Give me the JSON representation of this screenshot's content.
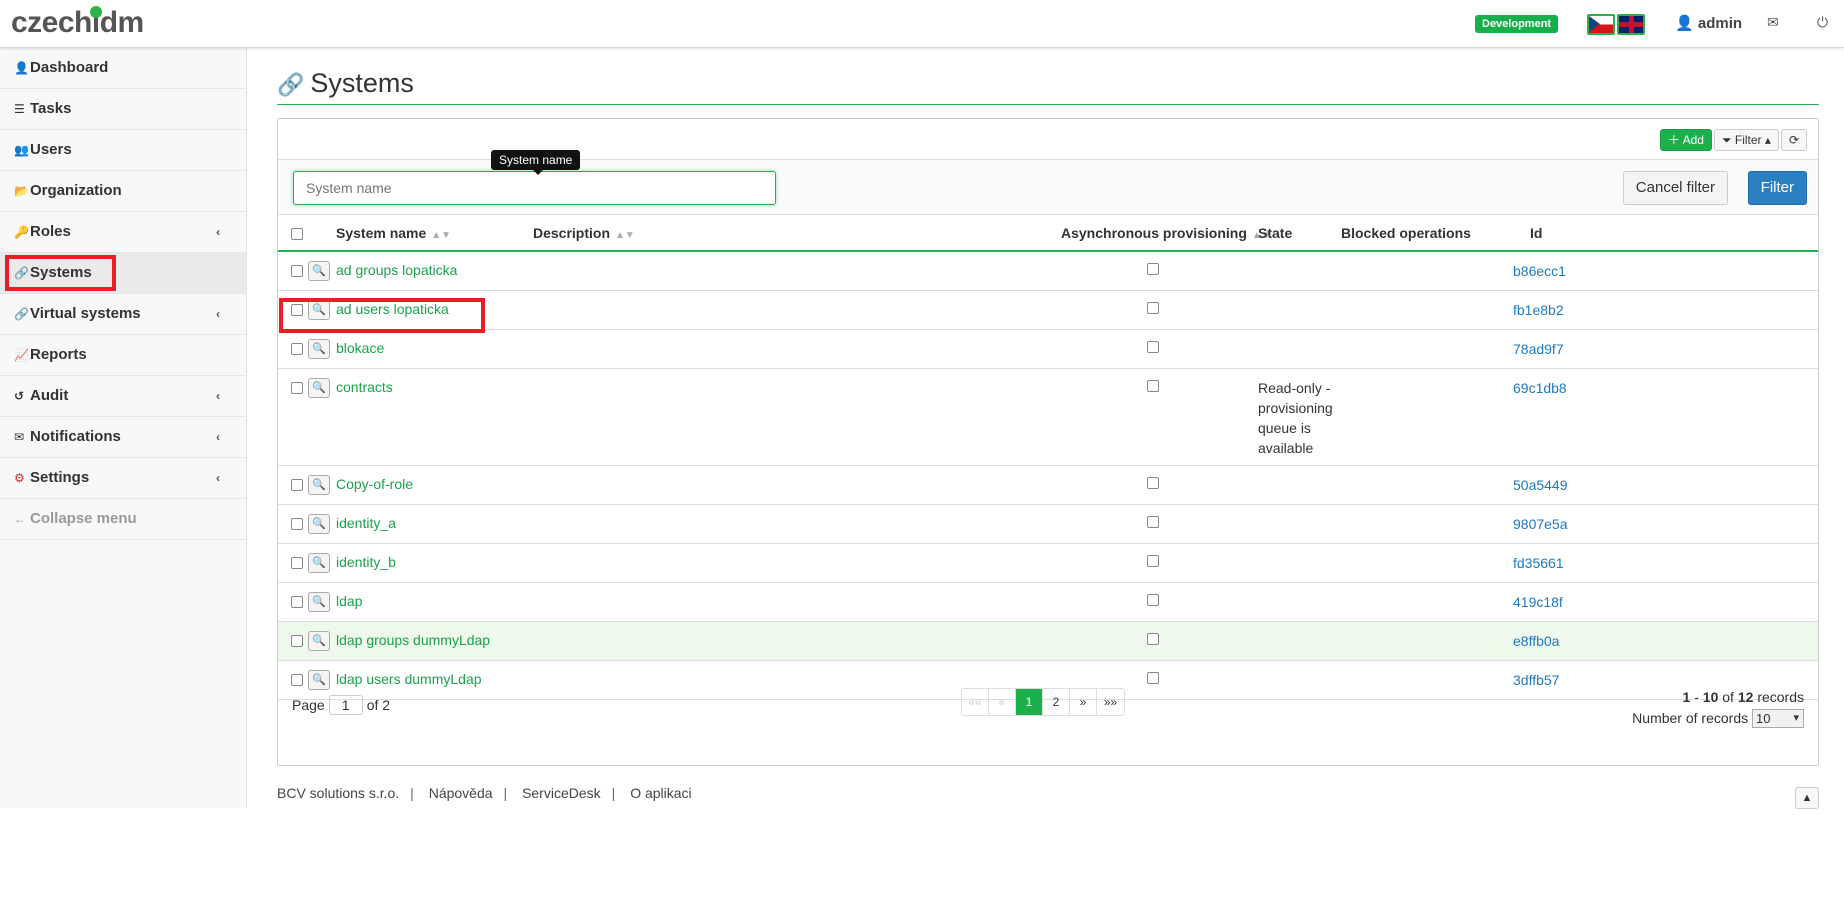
{
  "header": {
    "logo_text": "czech",
    "logo_suffix": "idm",
    "environment_badge": "Development",
    "user": "admin",
    "user_icon": "user-icon",
    "mail_icon": "mail-icon",
    "logout_icon": "power-icon",
    "colors": {
      "accent": "#1caf4b",
      "link_blue": "#1e7ac1"
    }
  },
  "sidebar": {
    "items": [
      {
        "label": "Dashboard",
        "icon": "👤"
      },
      {
        "label": "Tasks",
        "icon": "☰"
      },
      {
        "label": "Users",
        "icon": "👥"
      },
      {
        "label": "Organization",
        "icon": "📂"
      },
      {
        "label": "Roles",
        "icon": "🔑"
      },
      {
        "label": "Systems",
        "icon": "🔗"
      },
      {
        "label": "Virtual systems",
        "icon": "🔗"
      },
      {
        "label": "Reports",
        "icon": "📈"
      },
      {
        "label": "Audit",
        "icon": "↺"
      },
      {
        "label": "Notifications",
        "icon": "✉"
      },
      {
        "label": "Settings",
        "icon": "⚙"
      },
      {
        "label": "Collapse menu",
        "icon": "←"
      }
    ]
  },
  "main": {
    "title": "Systems",
    "toolbar": {
      "add": "Add",
      "filter": "Filter"
    },
    "filter": {
      "placeholder": "System name",
      "tooltip": "System name",
      "cancel": "Cancel filter",
      "submit": "Filter"
    },
    "columns": {
      "name": "System name",
      "description": "Description",
      "async": "Asynchronous provisioning",
      "state": "State",
      "blocked": "Blocked operations",
      "id": "Id"
    },
    "rows": [
      {
        "name": "ad groups lopaticka",
        "state": "",
        "id": "b86ecc1"
      },
      {
        "name": "ad users lopaticka",
        "state": "",
        "id": "fb1e8b2"
      },
      {
        "name": "blokace",
        "state": "",
        "id": "78ad9f7"
      },
      {
        "name": "contracts",
        "state": "Read-only - provisioning queue is available",
        "id": "69c1db8"
      },
      {
        "name": "Copy-of-role",
        "state": "",
        "id": "50a5449"
      },
      {
        "name": "identity_a",
        "state": "",
        "id": "9807e5a"
      },
      {
        "name": "identity_b",
        "state": "",
        "id": "fd35661"
      },
      {
        "name": "ldap",
        "state": "",
        "id": "419c18f"
      },
      {
        "name": "ldap groups dummyLdap",
        "state": "",
        "id": "e8ffb0a"
      },
      {
        "name": "ldap users dummyLdap",
        "state": "",
        "id": "3dffb57"
      }
    ],
    "pager": {
      "page_label": "Page",
      "page": "1",
      "of_label": "of 2",
      "buttons": [
        "««",
        "«",
        "1",
        "2",
        "»",
        "»»"
      ],
      "range_from": "1",
      "range_to": "10",
      "total": "12",
      "records_label": "records",
      "per_page_label": "Number of records",
      "per_page": "10"
    }
  },
  "footer": {
    "links": [
      "BCV solutions s.r.o.",
      "Nápověda",
      "ServiceDesk",
      "O aplikaci"
    ]
  }
}
